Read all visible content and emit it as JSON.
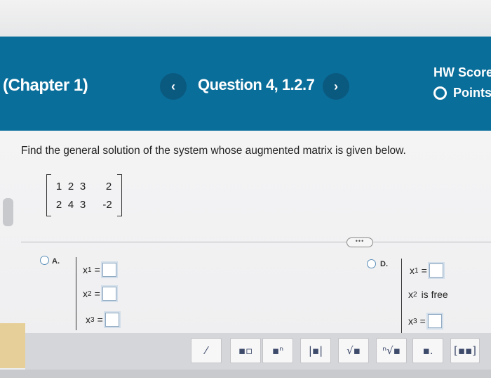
{
  "header": {
    "chapter": "(Chapter 1)",
    "question": "Question 4, 1.2.7",
    "prev_icon": "‹",
    "next_icon": "›",
    "hw_score": "HW Score",
    "points": "Points"
  },
  "question": {
    "prompt": "Find the general solution of the system whose augmented matrix is given below.",
    "matrix": {
      "rows": [
        [
          "1",
          "2",
          "3",
          "2"
        ],
        [
          "2",
          "4",
          "3",
          "-2"
        ]
      ]
    }
  },
  "more_label": "•••",
  "options": {
    "a": {
      "letter": "A.",
      "rows": [
        {
          "var": "x",
          "sub": "1",
          "eq": "="
        },
        {
          "var": "x",
          "sub": "2",
          "eq": "="
        },
        {
          "var": "x",
          "sub": "3",
          "eq": "="
        }
      ]
    },
    "d": {
      "letter": "D.",
      "rows": [
        {
          "var": "x",
          "sub": "1",
          "eq": "="
        },
        {
          "var": "x",
          "sub": "2",
          "text": "is free"
        },
        {
          "var": "x",
          "sub": "3",
          "eq": "="
        }
      ]
    }
  },
  "toolbar": {
    "buttons": [
      {
        "name": "fraction-icon",
        "glyph": "⁄"
      },
      {
        "name": "mixed-number-icon",
        "glyph": "▪▫"
      },
      {
        "name": "exponent-icon",
        "glyph": "▪ⁿ"
      },
      {
        "name": "absolute-value-icon",
        "glyph": "|▪|"
      },
      {
        "name": "square-root-icon",
        "glyph": "√▪"
      },
      {
        "name": "nth-root-icon",
        "glyph": "ⁿ√▪"
      },
      {
        "name": "decimal-icon",
        "glyph": "▪."
      },
      {
        "name": "matrix-icon",
        "glyph": "[▪▪]"
      }
    ]
  },
  "colors": {
    "header_bg": "#0a6e9a",
    "nav_btn_bg": "#0a5a80",
    "radio_border": "#5b8fb7"
  }
}
